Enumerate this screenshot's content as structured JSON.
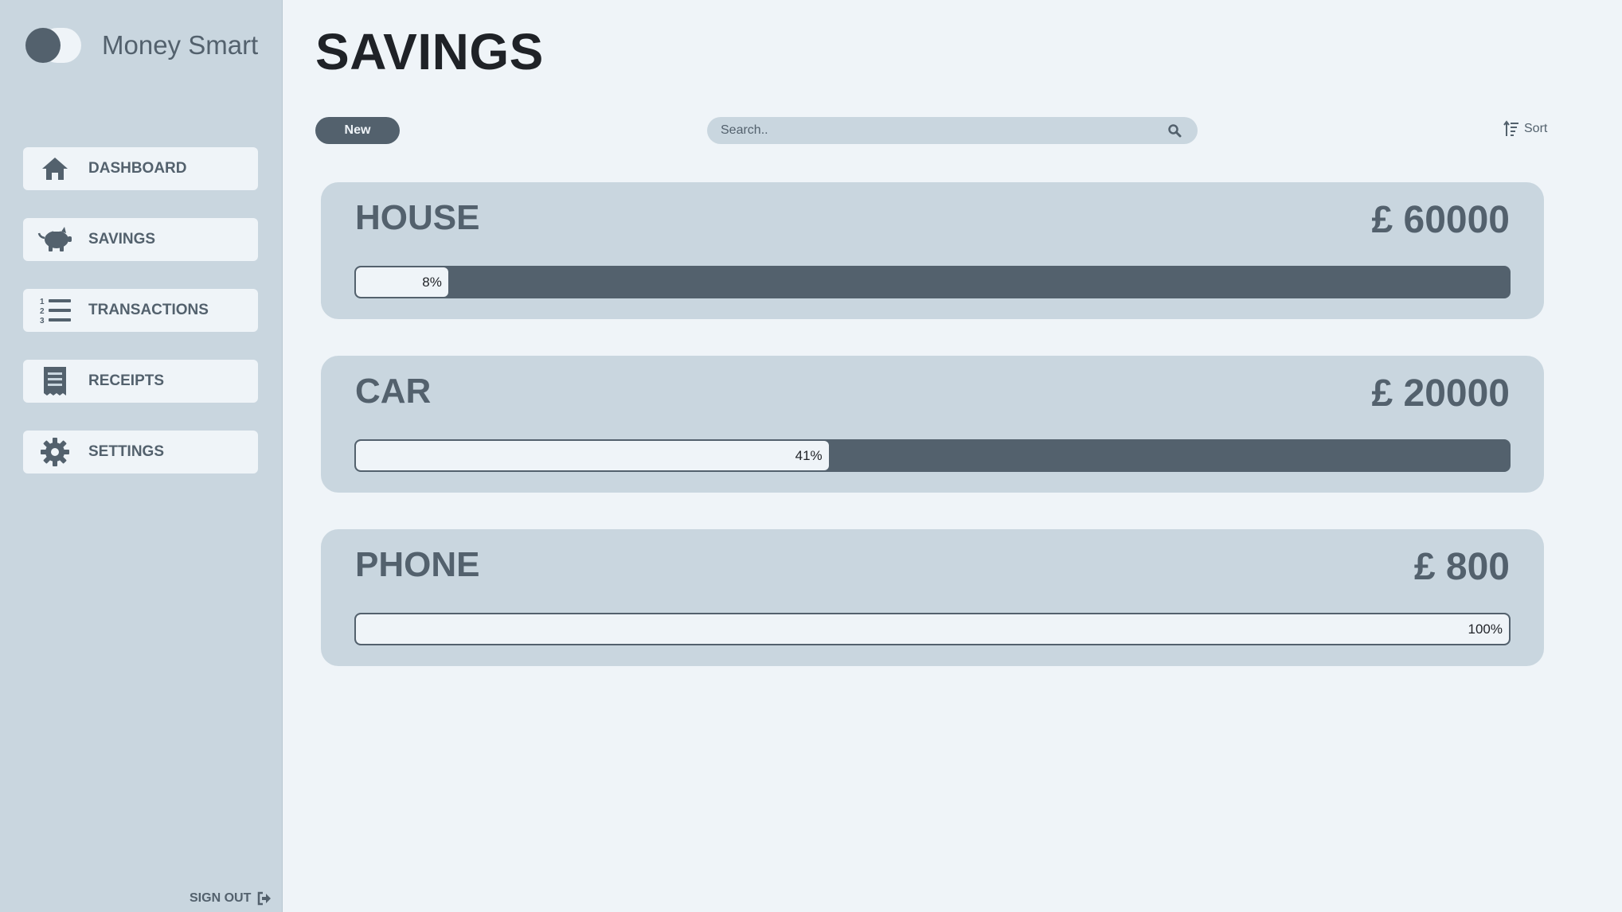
{
  "app": {
    "name": "Money Smart"
  },
  "sidebar": {
    "items": [
      {
        "label": "DASHBOARD",
        "icon": "home-icon"
      },
      {
        "label": "SAVINGS",
        "icon": "piggy-bank-icon"
      },
      {
        "label": "TRANSACTIONS",
        "icon": "list-ordered-icon"
      },
      {
        "label": "RECEIPTS",
        "icon": "receipt-icon"
      },
      {
        "label": "SETTINGS",
        "icon": "gear-icon"
      }
    ],
    "signout_label": "SIGN OUT"
  },
  "page": {
    "title": "SAVINGS"
  },
  "toolbar": {
    "new_label": "New",
    "search_placeholder": "Search..",
    "sort_label": "Sort"
  },
  "savings": [
    {
      "name": "HOUSE",
      "amount": "£ 60000",
      "percent_label": "8%",
      "progress": 0.08
    },
    {
      "name": "CAR",
      "amount": "£ 20000",
      "percent_label": "41%",
      "progress": 0.41
    },
    {
      "name": "PHONE",
      "amount": "£ 800",
      "percent_label": "100%",
      "progress": 1.0
    }
  ],
  "colors": {
    "sidebar_bg": "#c9d6df",
    "page_bg": "#eff4f8",
    "accent": "#53616d",
    "title": "#1f2227"
  }
}
